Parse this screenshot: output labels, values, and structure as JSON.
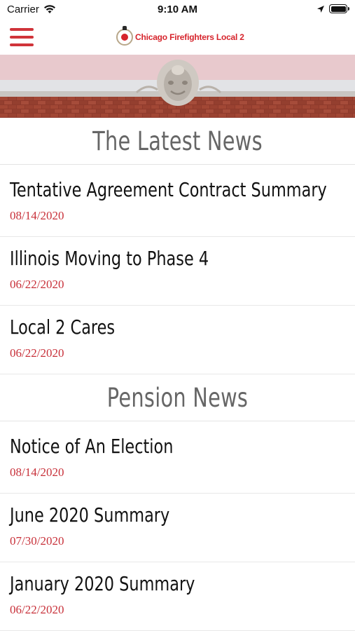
{
  "status": {
    "carrier": "Carrier",
    "time": "9:10 AM"
  },
  "header": {
    "logo_text": "Chicago Firefighters Local 2",
    "menu_icon": "hamburger-menu-icon"
  },
  "colors": {
    "accent": "#d0343a",
    "date": "#c8313a",
    "section_title": "#666666"
  },
  "latest_news": {
    "title": "The Latest News",
    "items": [
      {
        "title": "Tentative Agreement Contract Summary",
        "date": "08/14/2020"
      },
      {
        "title": "Illinois Moving to Phase 4",
        "date": "06/22/2020"
      },
      {
        "title": "Local 2 Cares",
        "date": "06/22/2020"
      }
    ]
  },
  "pension_news": {
    "title": "Pension News",
    "items": [
      {
        "title": "Notice of An Election",
        "date": "08/14/2020"
      },
      {
        "title": "June 2020 Summary",
        "date": "07/30/2020"
      },
      {
        "title": "January 2020 Summary",
        "date": "06/22/2020"
      }
    ]
  }
}
